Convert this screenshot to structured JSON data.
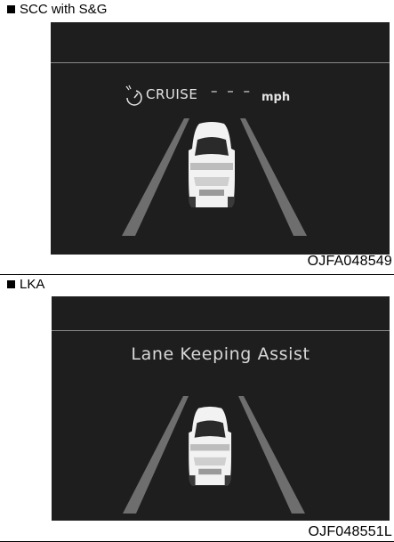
{
  "panels": [
    {
      "title": "SCC with S&G",
      "display": {
        "icon": "cruise-speedometer-icon",
        "mode_label": "CRUISE",
        "speed_value": "– – –",
        "speed_unit": "mph"
      },
      "code": "OJFA048549"
    },
    {
      "title": "LKA",
      "display": {
        "message": "Lane Keeping Assist"
      },
      "code": "OJF048551L"
    }
  ],
  "colors": {
    "screen_background": "#1e1e1e",
    "divider": "#8a8a8a",
    "display_text": "#e4e4e4"
  }
}
